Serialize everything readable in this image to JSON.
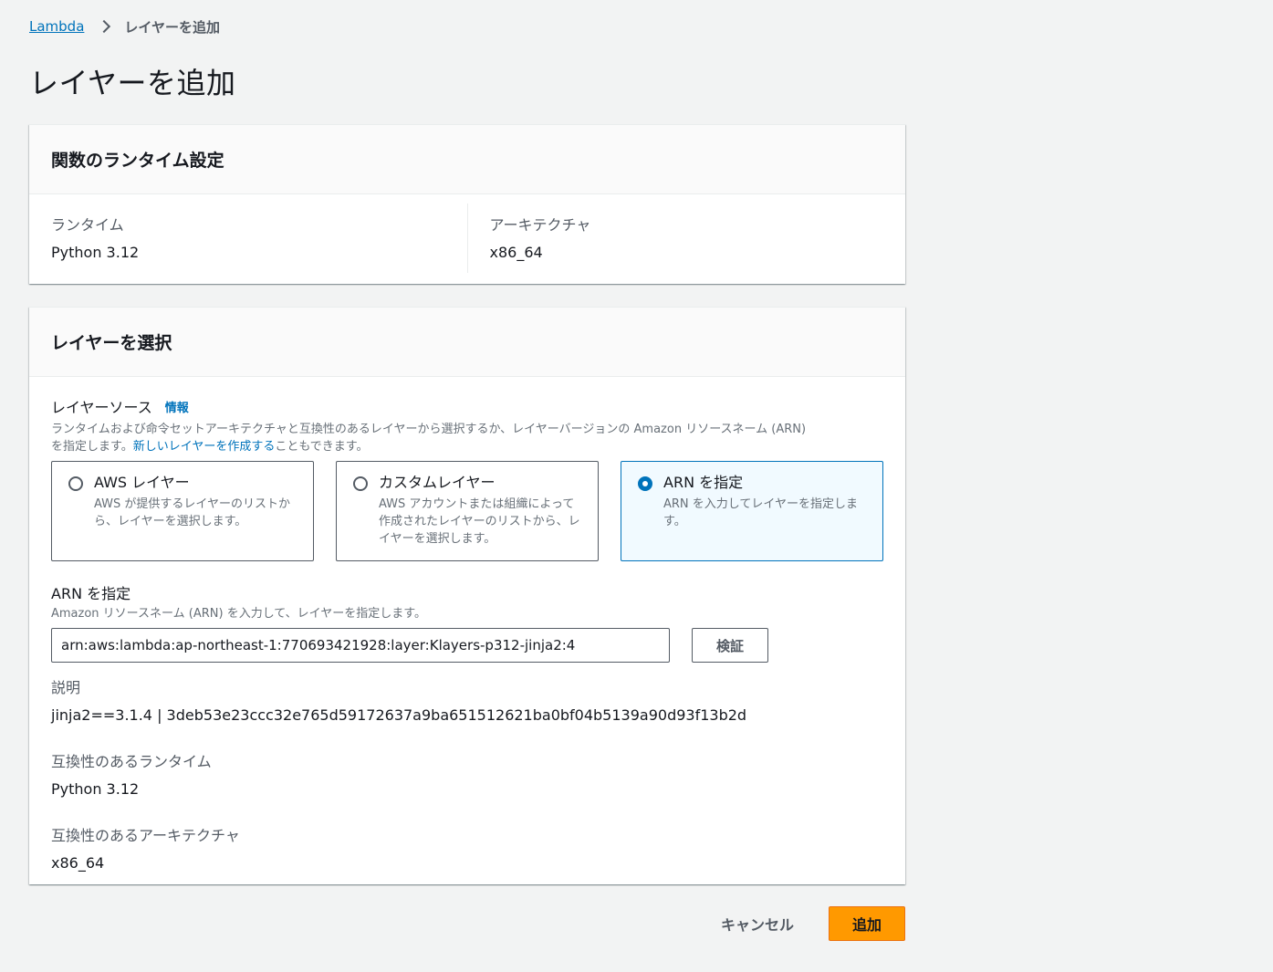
{
  "breadcrumb": {
    "root": "Lambda",
    "current": "レイヤーを追加"
  },
  "page_title": "レイヤーを追加",
  "runtime_panel": {
    "title": "関数のランタイム設定",
    "runtime_label": "ランタイム",
    "runtime_value": "Python 3.12",
    "arch_label": "アーキテクチャ",
    "arch_value": "x86_64"
  },
  "layer_panel": {
    "title": "レイヤーを選択",
    "source_label": "レイヤーソース",
    "info_link": "情報",
    "source_desc_1": "ランタイムおよび命令セットアーキテクチャと互換性のあるレイヤーから選択するか、レイヤーバージョンの Amazon リソースネーム (ARN)",
    "source_desc_2a": "を指定します。",
    "source_desc_link": "新しいレイヤーを作成する",
    "source_desc_2b": "こともできます。",
    "tiles": [
      {
        "title": "AWS レイヤー",
        "desc": "AWS が提供するレイヤーのリストから、レイヤーを選択します。",
        "selected": false
      },
      {
        "title": "カスタムレイヤー",
        "desc": "AWS アカウントまたは組織によって作成されたレイヤーのリストから、レイヤーを選択します。",
        "selected": false
      },
      {
        "title": "ARN を指定",
        "desc": "ARN を入力してレイヤーを指定します。",
        "selected": true
      }
    ],
    "arn_label": "ARN を指定",
    "arn_desc": "Amazon リソースネーム (ARN) を入力して、レイヤーを指定します。",
    "arn_value": "arn:aws:lambda:ap-northeast-1:770693421928:layer:Klayers-p312-jinja2:4",
    "verify_button": "検証",
    "description_label": "説明",
    "description_value": "jinja2==3.1.4 | 3deb53e23ccc32e765d59172637a9ba651512621ba0bf04b5139a90d93f13b2d",
    "compat_runtime_label": "互換性のあるランタイム",
    "compat_runtime_value": "Python 3.12",
    "compat_arch_label": "互換性のあるアーキテクチャ",
    "compat_arch_value": "x86_64"
  },
  "footer": {
    "cancel": "キャンセル",
    "add": "追加"
  },
  "colors": {
    "primary": "#ff9900",
    "link": "#0073bb",
    "background": "#f2f3f3"
  }
}
